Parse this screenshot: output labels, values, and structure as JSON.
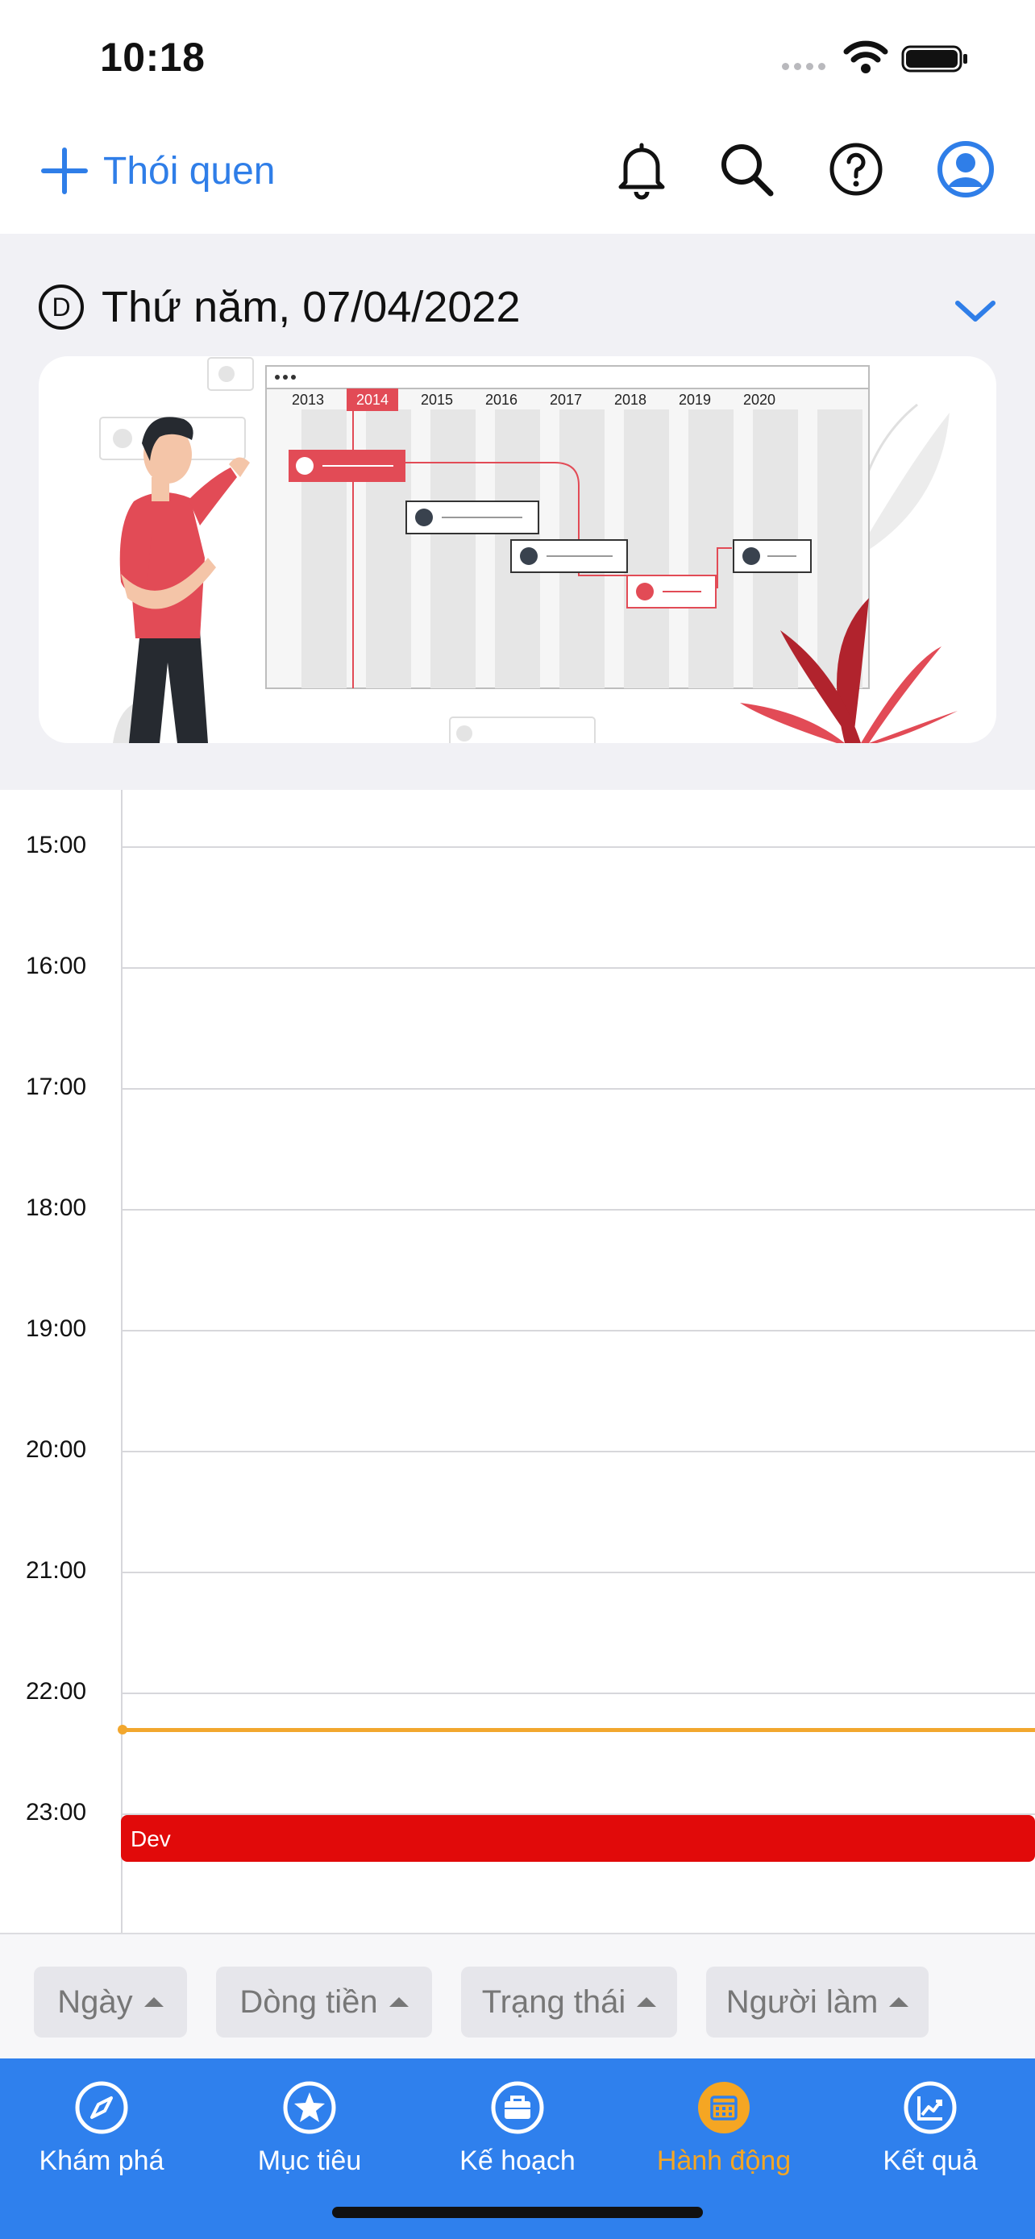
{
  "status_bar": {
    "time": "10:18"
  },
  "header": {
    "title": "Thói quen",
    "icons": [
      "plus-icon",
      "bell-icon",
      "search-icon",
      "help-icon",
      "profile-icon"
    ]
  },
  "date": {
    "badge": "D",
    "label": "Thứ năm, 07/04/2022"
  },
  "banner": {
    "years": [
      "2013",
      "2014",
      "2015",
      "2016",
      "2017",
      "2018",
      "2019",
      "2020"
    ],
    "highlighted_year": "2014"
  },
  "calendar": {
    "hours": [
      "15:00",
      "16:00",
      "17:00",
      "18:00",
      "19:00",
      "20:00",
      "21:00",
      "22:00",
      "23:00"
    ],
    "events": [
      {
        "title": "Dev",
        "color": "#e10a0a"
      }
    ],
    "now_line_color": "#f2a72e"
  },
  "filters": [
    {
      "label": "Ngày"
    },
    {
      "label": "Dòng tiền"
    },
    {
      "label": "Trạng thái"
    },
    {
      "label": "Người làm"
    }
  ],
  "tabs": [
    {
      "label": "Khám phá",
      "icon": "compass-icon",
      "active": false
    },
    {
      "label": "Mục tiêu",
      "icon": "star-icon",
      "active": false
    },
    {
      "label": "Kế hoạch",
      "icon": "briefcase-icon",
      "active": false
    },
    {
      "label": "Hành động",
      "icon": "calendar-icon",
      "active": true
    },
    {
      "label": "Kết quả",
      "icon": "chart-icon",
      "active": false
    }
  ],
  "colors": {
    "accent": "#2f7ee8",
    "tabbar": "#2f80ed",
    "active_tab": "#f5a623"
  }
}
